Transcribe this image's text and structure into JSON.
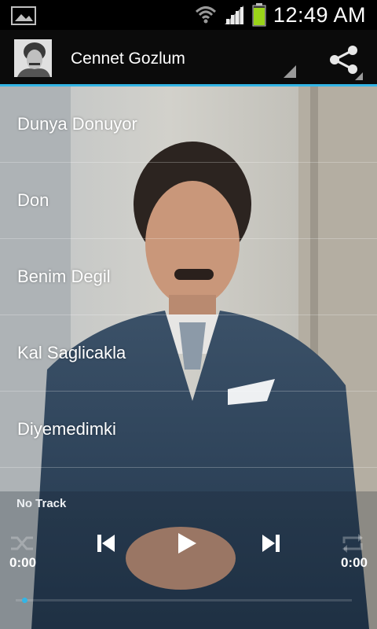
{
  "status_bar": {
    "time": "12:49 AM",
    "icons": [
      "gallery-icon",
      "wifi-icon",
      "signal-icon",
      "battery-icon"
    ]
  },
  "action_bar": {
    "title": "Cennet Gozlum",
    "icons": [
      "album-art",
      "dropdown-icon",
      "share-icon"
    ]
  },
  "tracks": [
    {
      "label": "Dunya Donuyor"
    },
    {
      "label": "Don"
    },
    {
      "label": "Benim Degil"
    },
    {
      "label": "Kal Saglicakla"
    },
    {
      "label": "Diyemedimki"
    }
  ],
  "player": {
    "now_playing": "No Track",
    "elapsed": "0:00",
    "duration": "0:00",
    "progress": 0,
    "controls": [
      "shuffle-icon",
      "previous-icon",
      "play-icon",
      "next-icon",
      "repeat-icon"
    ]
  },
  "colors": {
    "accent": "#33b5e5",
    "status_bar": "#000000",
    "action_bar": "#0b0b0b"
  }
}
